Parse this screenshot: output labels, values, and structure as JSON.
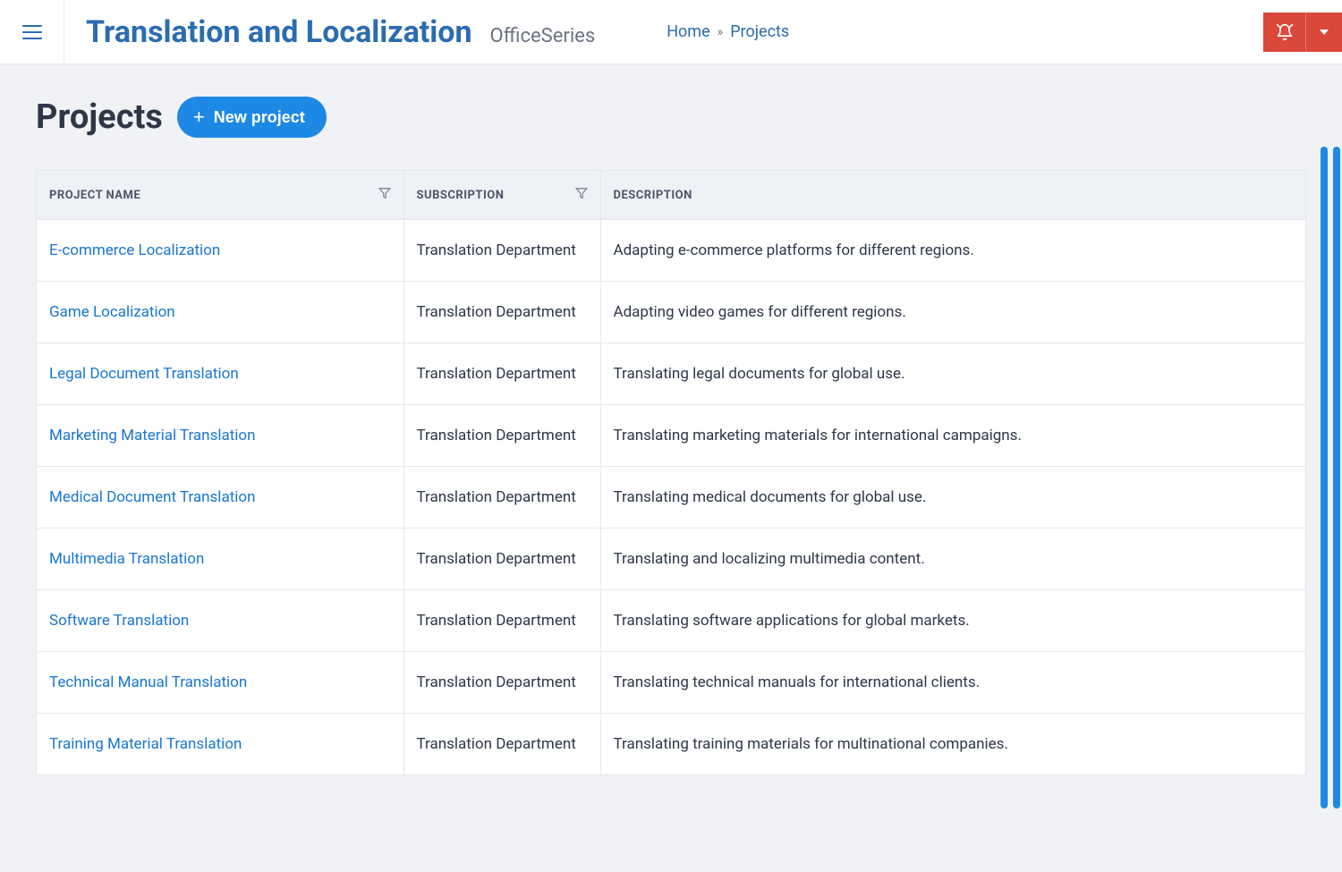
{
  "header": {
    "app_title": "Translation and Localization",
    "app_subtitle": "OfficeSeries"
  },
  "breadcrumb": {
    "home": "Home",
    "separator": "»",
    "current": "Projects"
  },
  "page": {
    "title": "Projects",
    "new_project_label": "New project"
  },
  "table": {
    "columns": {
      "project_name": "Project Name",
      "subscription": "Subscription",
      "description": "Description"
    },
    "rows": [
      {
        "name": "E-commerce Localization",
        "subscription": "Translation Department",
        "description": "Adapting e-commerce platforms for different regions."
      },
      {
        "name": "Game Localization",
        "subscription": "Translation Department",
        "description": "Adapting video games for different regions."
      },
      {
        "name": "Legal Document Translation",
        "subscription": "Translation Department",
        "description": "Translating legal documents for global use."
      },
      {
        "name": "Marketing Material Translation",
        "subscription": "Translation Department",
        "description": "Translating marketing materials for international campaigns."
      },
      {
        "name": "Medical Document Translation",
        "subscription": "Translation Department",
        "description": "Translating medical documents for global use."
      },
      {
        "name": "Multimedia Translation",
        "subscription": "Translation Department",
        "description": "Translating and localizing multimedia content."
      },
      {
        "name": "Software Translation",
        "subscription": "Translation Department",
        "description": "Translating software applications for global markets."
      },
      {
        "name": "Technical Manual Translation",
        "subscription": "Translation Department",
        "description": "Translating technical manuals for international clients."
      },
      {
        "name": "Training Material Translation",
        "subscription": "Translation Department",
        "description": "Translating training materials for multinational companies."
      }
    ]
  }
}
